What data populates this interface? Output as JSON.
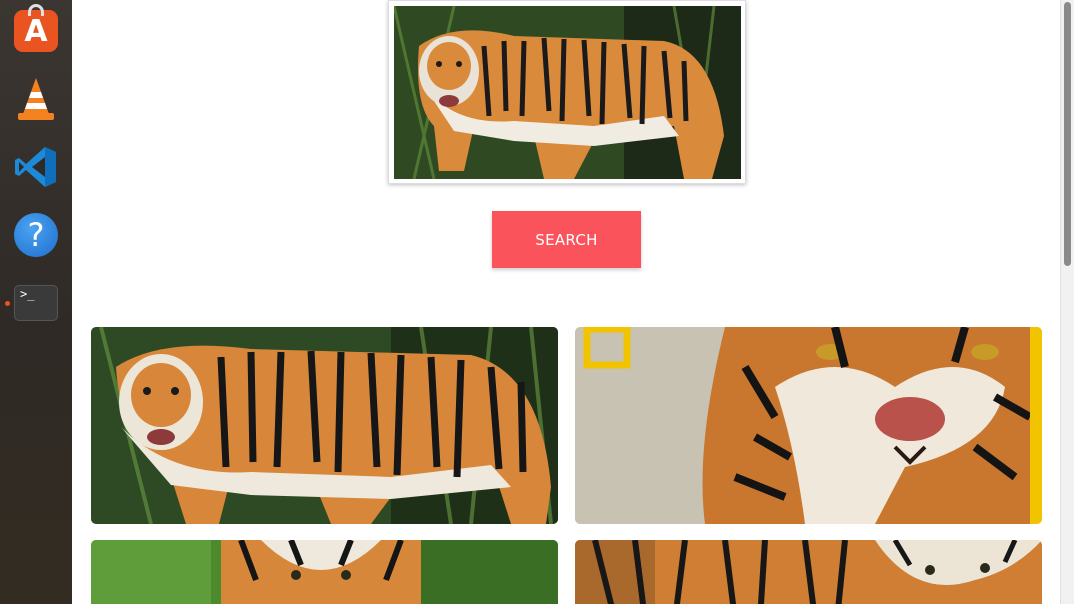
{
  "dock": {
    "items": [
      {
        "name": "ubuntu-software",
        "icon": "app-store-icon",
        "glyph": "A"
      },
      {
        "name": "vlc",
        "icon": "vlc-cone-icon"
      },
      {
        "name": "vs-code",
        "icon": "vscode-icon"
      },
      {
        "name": "help",
        "icon": "help-icon",
        "glyph": "?"
      },
      {
        "name": "terminal",
        "icon": "terminal-icon",
        "glyph": ">_"
      }
    ],
    "running_indicator_color": "#e95420"
  },
  "page": {
    "search_button_label": "SEARCH",
    "search_button_color": "#fa535b"
  },
  "results": [
    {
      "subject": "tiger-standing"
    },
    {
      "subject": "tiger-face-closeup"
    },
    {
      "subject": "tiger-in-greenery"
    },
    {
      "subject": "tiger-walking"
    }
  ]
}
